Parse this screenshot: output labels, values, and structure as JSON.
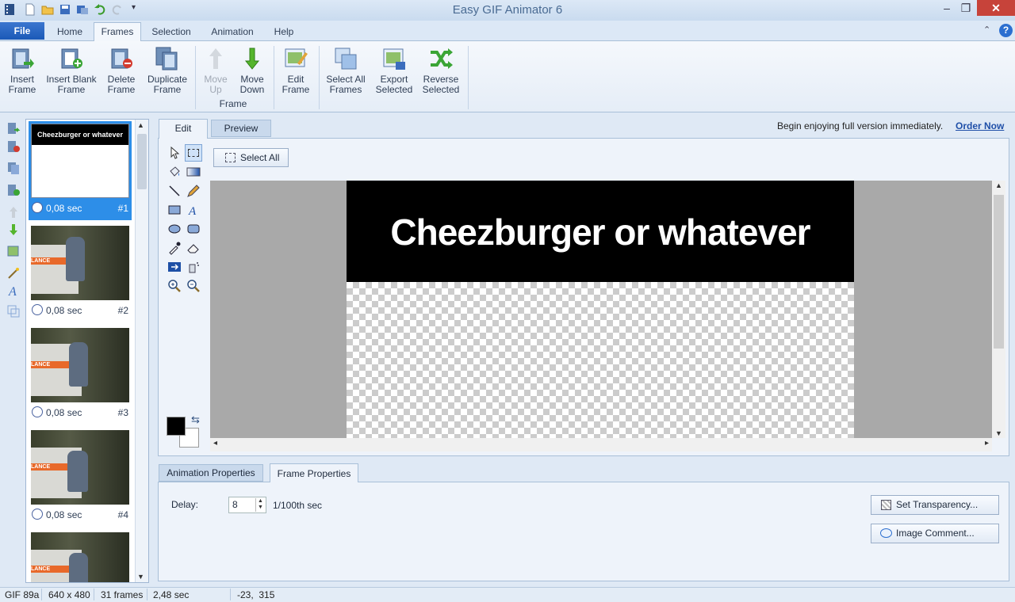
{
  "window": {
    "title": "Easy GIF Animator 6"
  },
  "ribbon": {
    "tabs": [
      "File",
      "Home",
      "Frames",
      "Selection",
      "Animation",
      "Help"
    ],
    "active_tab": "Frames",
    "buttons": {
      "insert_frame": "Insert\nFrame",
      "insert_blank_frame": "Insert Blank\nFrame",
      "delete_frame": "Delete\nFrame",
      "duplicate_frame": "Duplicate\nFrame",
      "move_up": "Move\nUp",
      "move_down": "Move\nDown",
      "edit_frame": "Edit\nFrame",
      "select_all_frames": "Select All\nFrames",
      "export_selected": "Export\nSelected",
      "reverse_selected": "Reverse\nSelected"
    },
    "group_label": "Frame"
  },
  "frames": [
    {
      "delay": "0,08 sec",
      "number": "#1",
      "selected": true,
      "thumb_text": "Cheezburger or whatever"
    },
    {
      "delay": "0,08 sec",
      "number": "#2",
      "selected": false
    },
    {
      "delay": "0,08 sec",
      "number": "#3",
      "selected": false
    },
    {
      "delay": "0,08 sec",
      "number": "#4",
      "selected": false
    },
    {
      "delay": "",
      "number": "",
      "selected": false
    }
  ],
  "thumb_van_text": "LANCE",
  "editor": {
    "tabs": [
      "Edit",
      "Preview"
    ],
    "active_tab": "Edit",
    "promo_text": "Begin enjoying full version immediately.",
    "order_link": "Order Now",
    "select_all_label": "Select All",
    "canvas_text": "Cheezburger or whatever",
    "colors": {
      "foreground": "#000000",
      "background": "#ffffff"
    }
  },
  "properties": {
    "tabs": [
      "Animation Properties",
      "Frame Properties"
    ],
    "active_tab": "Frame Properties",
    "delay_label": "Delay:",
    "delay_value": "8",
    "delay_unit": "1/100th sec",
    "set_transparency": "Set Transparency...",
    "image_comment": "Image Comment..."
  },
  "status": {
    "format": "GIF 89a",
    "size": "640 x 480",
    "frames": "31 frames",
    "duration": "2,48 sec",
    "cursor": "-23,  315"
  }
}
